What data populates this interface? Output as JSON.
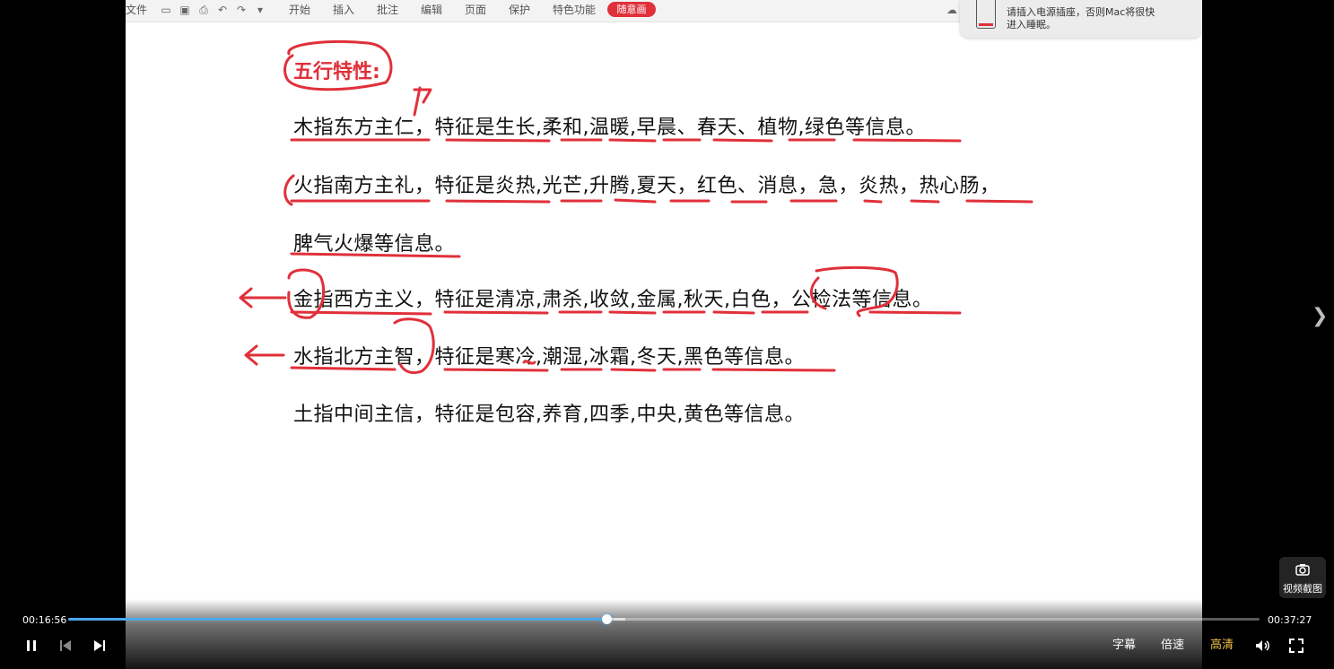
{
  "toolbar": {
    "file_label": "文件",
    "menus": [
      "开始",
      "插入",
      "批注",
      "编辑",
      "页面",
      "保护",
      "特色功能"
    ],
    "active_tab": "随意画"
  },
  "notification": {
    "line1": "请插入电源插座，否则Mac将很快",
    "line2": "进入睡眠。"
  },
  "doc": {
    "title": "五行特性:",
    "lines": [
      "木指东方主仁，特征是生长,柔和,温暖,早晨、春天、植物,绿色等信息。",
      "火指南方主礼，特征是炎热,光芒,升腾,夏天，红色、消息，急，炎热，热心肠，",
      "脾气火爆等信息。",
      "金指西方主义，特征是清凉,肃杀,收敛,金属,秋天,白色，公检法等信息。",
      "水指北方主智，特征是寒冷,潮湿,冰霜,冬天,黑色等信息。",
      "土指中间主信，特征是包容,养育,四季,中央,黄色等信息。"
    ]
  },
  "player": {
    "current_time": "00:16:56",
    "total_time": "00:37:27",
    "progress_fraction": 0.452,
    "buffered_fraction": 0.468,
    "subtitle_label": "字幕",
    "speed_label": "倍速",
    "quality_label": "高清",
    "snapshot_label": "视频截图",
    "accent_color": "#4aa8e8",
    "ink_color": "#e0303a"
  }
}
